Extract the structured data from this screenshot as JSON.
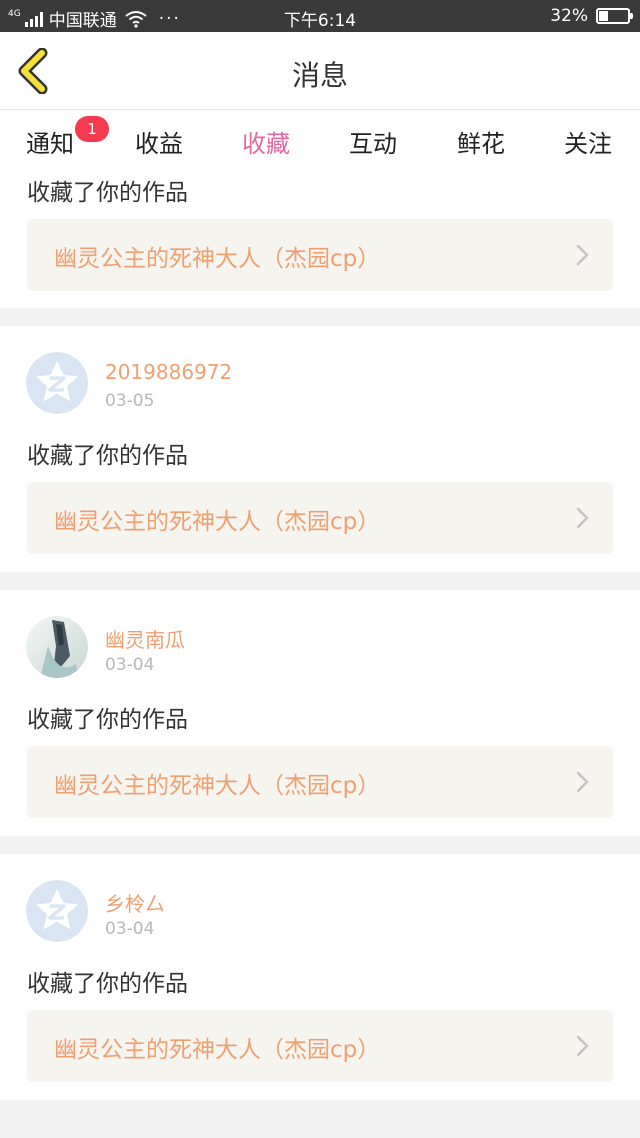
{
  "status_bar": {
    "carrier": "中国联通",
    "network": "4G",
    "time": "下午6:14",
    "battery_text": "32%",
    "battery_level": 0.32,
    "more": "···"
  },
  "header": {
    "title": "消息"
  },
  "tabs": [
    {
      "label": "通知",
      "badge": "1"
    },
    {
      "label": "收益"
    },
    {
      "label": "收藏",
      "active": true
    },
    {
      "label": "互动"
    },
    {
      "label": "鲜花"
    },
    {
      "label": "关注"
    }
  ],
  "items": [
    {
      "action": "收藏了你的作品",
      "work_title": "幽灵公主的死神大人（杰园cp）"
    },
    {
      "username": "2019886972",
      "date": "03-05",
      "avatar": "default-avatar-icon",
      "action": "收藏了你的作品",
      "work_title": "幽灵公主的死神大人（杰园cp）"
    },
    {
      "username": "幽灵南瓜",
      "date": "03-04",
      "avatar": "photo-avatar",
      "action": "收藏了你的作品",
      "work_title": "幽灵公主的死神大人（杰园cp）"
    },
    {
      "username": "乡柃厶",
      "date": "03-04",
      "avatar": "default-avatar-icon",
      "action": "收藏了你的作品",
      "work_title": "幽灵公主的死神大人（杰园cp）"
    }
  ],
  "colors": {
    "accent": "#e8689d",
    "username": "#f0a070",
    "badge": "#f53b4f",
    "work_box": "#f5f4ef"
  }
}
